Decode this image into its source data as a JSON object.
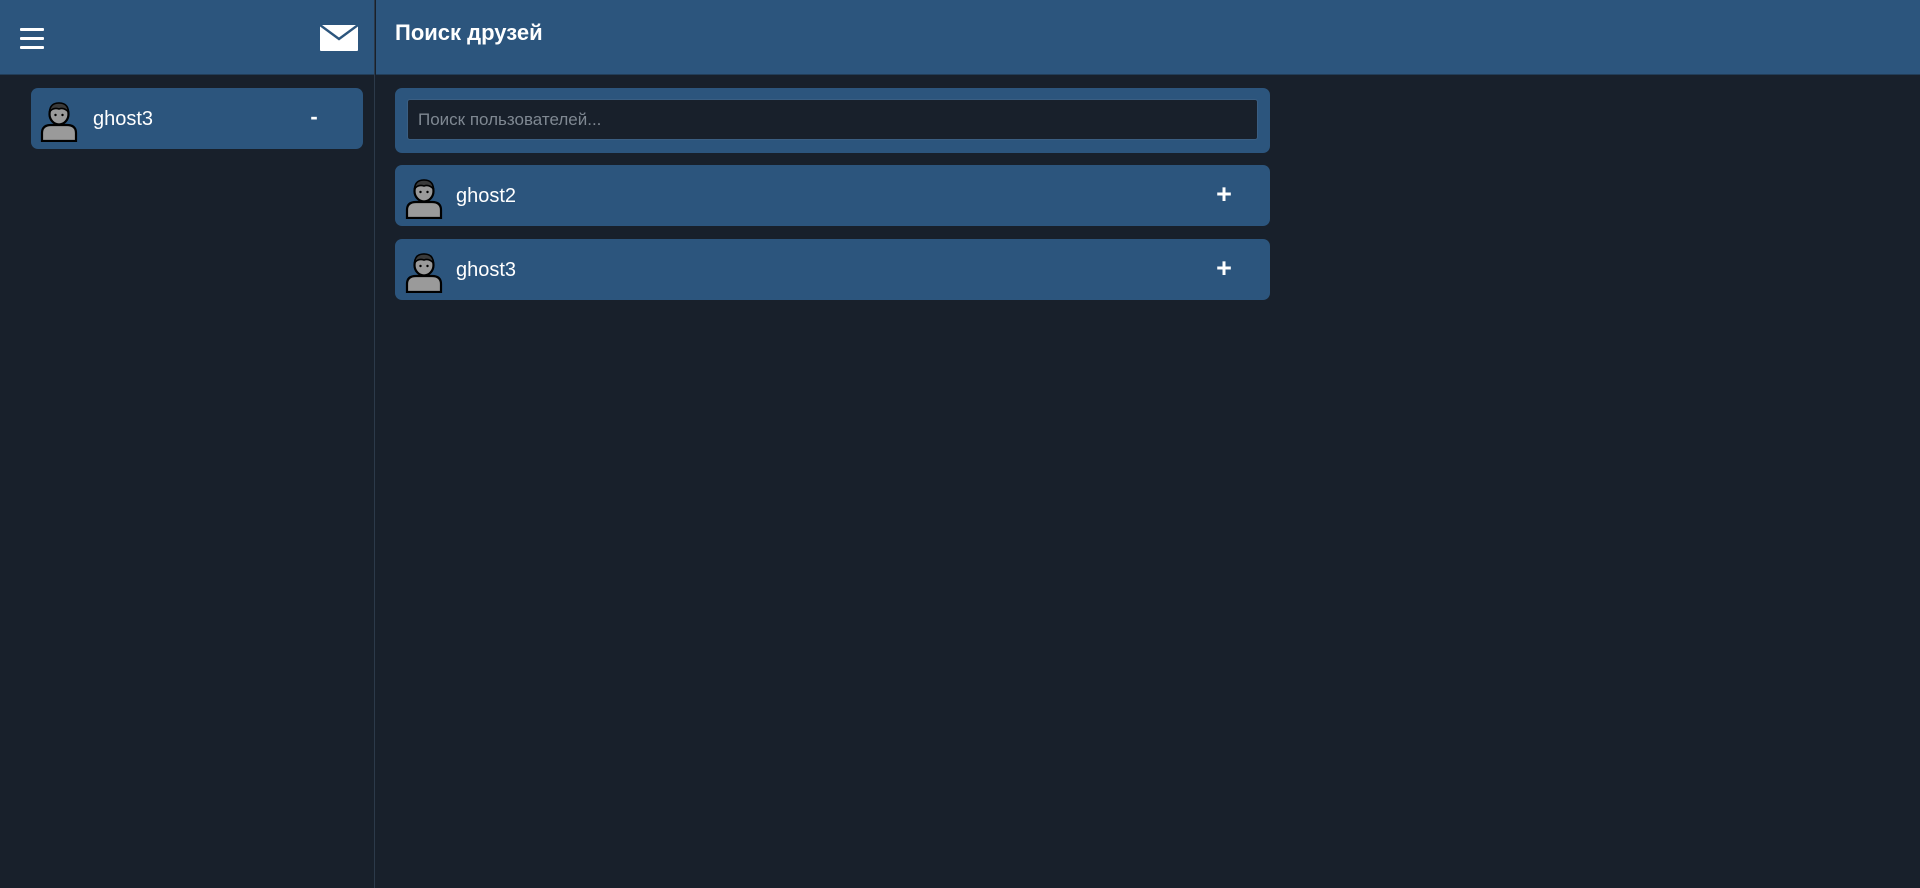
{
  "colors": {
    "background": "#18202b",
    "header": "#2c557d",
    "card": "#2c557d",
    "text": "#ffffff",
    "placeholder": "#7f8892"
  },
  "sidebar": {
    "menu_icon": "hamburger-icon",
    "mail_icon": "envelope-icon",
    "friends": [
      {
        "name": "ghost3",
        "avatar_icon": "user-avatar-icon",
        "action_label": "-"
      }
    ]
  },
  "main": {
    "title": "Поиск друзей",
    "search": {
      "placeholder": "Поиск пользователей...",
      "value": ""
    },
    "results": [
      {
        "name": "ghost2",
        "avatar_icon": "user-avatar-icon",
        "action_label": "+"
      },
      {
        "name": "ghost3",
        "avatar_icon": "user-avatar-icon",
        "action_label": "+"
      }
    ]
  }
}
